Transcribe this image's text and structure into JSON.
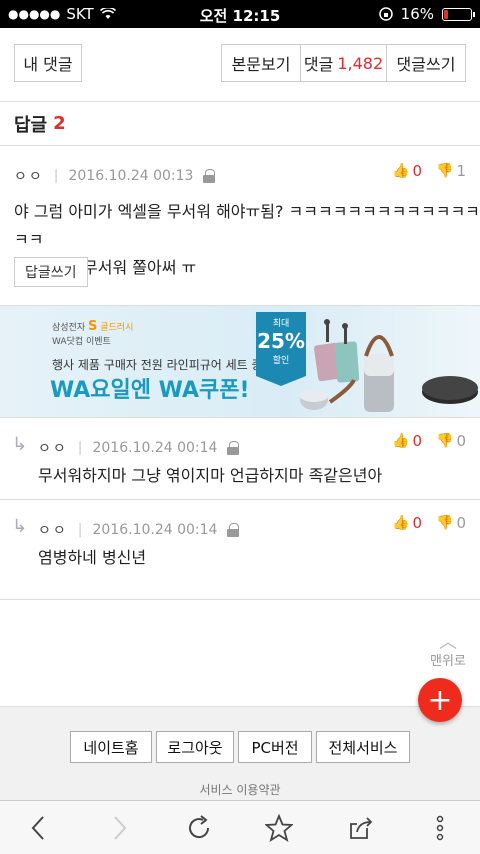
{
  "status": {
    "carrier": "SKT",
    "time": "오전 12:15",
    "battery": "16%",
    "battery_level": 0.16
  },
  "topbar": {
    "my_comments": "내 댓글",
    "view_article": "본문보기",
    "comments_label": "댓글",
    "comments_count": "1,482",
    "write_comment": "댓글쓰기"
  },
  "reply_header": {
    "label": "답글",
    "count": "2"
  },
  "comments": [
    {
      "author": "ㅇㅇ",
      "date": "2016.10.24 00:13",
      "up": "0",
      "down": "1",
      "line1": "야 그럼 아미가 엑셀을 무서워 해야ㅠ됨? ㅋㅋㅋㅋㅋㅋㅋㅋㅋㅋㅋㅋㅋㅋㅋ",
      "line2": "ㅋ 아이고 무서워 쫄아써 ㅠ",
      "reply_btn": "답글쓰기"
    },
    {
      "author": "ㅇㅇ",
      "date": "2016.10.24 00:14",
      "up": "0",
      "down": "0",
      "text": "무서워하지마 그냥 엮이지마 언급하지마 족같은년아"
    },
    {
      "author": "ㅇㅇ",
      "date": "2016.10.24 00:14",
      "up": "0",
      "down": "0",
      "text": "염병하네 병신년"
    }
  ],
  "ad": {
    "brand": "삼성전자",
    "brand_mark": "S",
    "brand_program": "골드러시",
    "sub": "WA닷컵 이벤트",
    "desc": "행사 제품 구매자 전원 라인피규어 세트 증정",
    "headline": "WA요일엔 WA쿠폰!",
    "badge_small": "최대",
    "badge_big": "25%",
    "badge_unit": "할인"
  },
  "top_link": "맨위로",
  "footer": {
    "home": "네이트홈",
    "logout": "로그아웃",
    "pc": "PC버전",
    "all": "전체서비스",
    "terms": "서비스 이용약관"
  },
  "icons": {
    "wifi": "wifi-icon",
    "lock": "lock-icon",
    "thumb_up": "thumb-up-icon",
    "thumb_down": "thumb-down-icon",
    "reply_arrow": "reply-arrow-icon",
    "plus": "plus-icon",
    "back": "back-icon",
    "forward": "forward-icon",
    "reload": "reload-icon",
    "bookmark": "star-icon",
    "share": "share-icon",
    "more": "more-icon"
  },
  "colors": {
    "accent": "#e32b2b",
    "fab": "#ef2b1e",
    "ad_headline": "#1a9ac0"
  }
}
